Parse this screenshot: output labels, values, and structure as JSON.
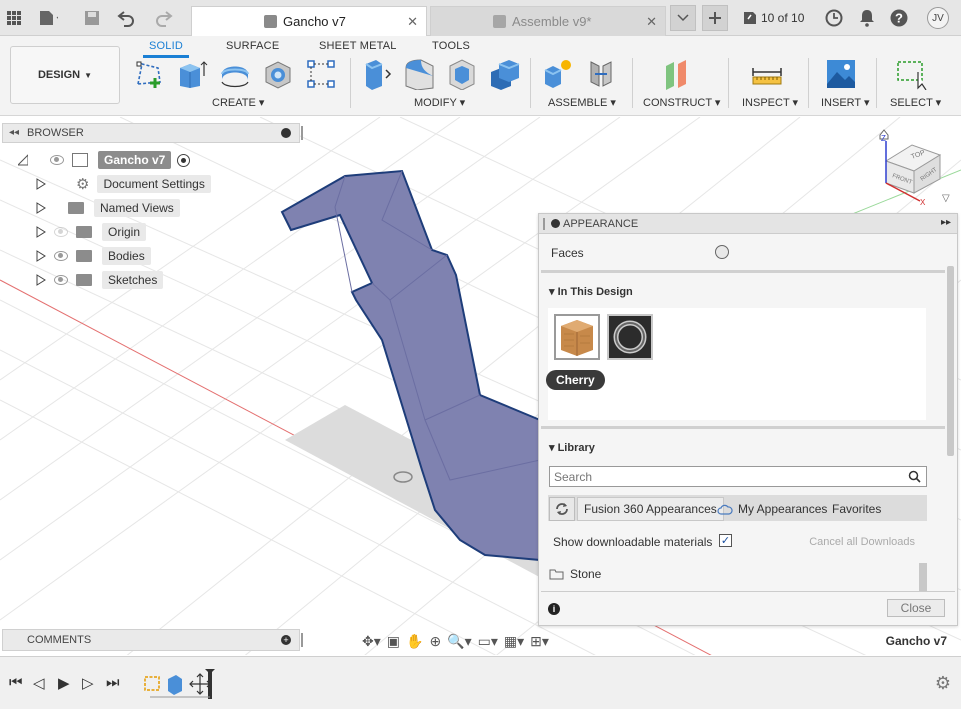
{
  "topbar": {
    "tabs": [
      {
        "label": "Gancho v7",
        "active": true
      },
      {
        "label": "Assemble v9*",
        "active": false
      }
    ],
    "job_status": "10 of 10",
    "user_initials": "JV"
  },
  "ribbon": {
    "tabs": [
      "SOLID",
      "SURFACE",
      "SHEET METAL",
      "TOOLS"
    ],
    "workspace": "DESIGN",
    "groups": [
      "CREATE",
      "MODIFY",
      "ASSEMBLE",
      "CONSTRUCT",
      "INSPECT",
      "INSERT",
      "SELECT"
    ]
  },
  "browser": {
    "title": "BROWSER",
    "root": "Gancho v7",
    "items": [
      {
        "label": "Document Settings",
        "icon": "gear-icon"
      },
      {
        "label": "Named Views",
        "icon": "folder-icon"
      },
      {
        "label": "Origin",
        "icon": "folder-icon"
      },
      {
        "label": "Bodies",
        "icon": "folder-icon"
      },
      {
        "label": "Sketches",
        "icon": "folder-icon"
      }
    ]
  },
  "comments": {
    "title": "COMMENTS"
  },
  "appearance": {
    "title": "APPEARANCE",
    "faces_label": "Faces",
    "in_design_title": "In This Design",
    "selected_material": "Cherry",
    "library_title": "Library",
    "search_placeholder": "Search",
    "library_tabs": [
      "Fusion 360 Appearances",
      "My Appearances",
      "Favorites"
    ],
    "show_downloadable": "Show downloadable materials",
    "cancel_downloads": "Cancel all Downloads",
    "folder_item": "Stone",
    "close_label": "Close"
  },
  "viewcube": {
    "top": "TOP",
    "front": "FRONT",
    "right": "RIGHT"
  },
  "status": {
    "document_name": "Gancho v7"
  },
  "colors": {
    "accent": "#1a7fd4",
    "body": "#7f82b0",
    "body_edge": "#1e3d7a"
  }
}
